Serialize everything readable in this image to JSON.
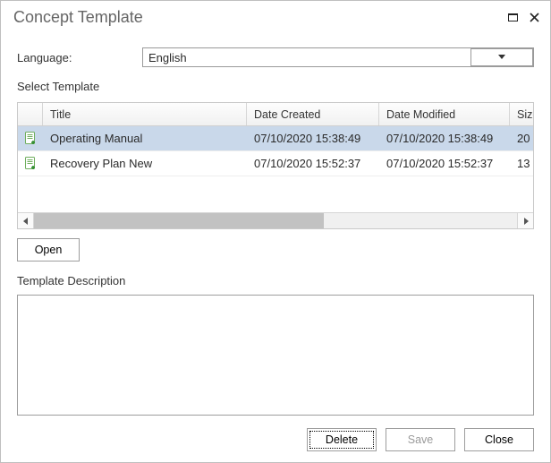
{
  "window": {
    "title": "Concept Template"
  },
  "language": {
    "label": "Language:",
    "value": "English"
  },
  "select_template_label": "Select Template",
  "grid": {
    "columns": {
      "title": "Title",
      "created": "Date Created",
      "modified": "Date Modified",
      "size": "Size"
    },
    "rows": [
      {
        "title": "Operating Manual",
        "created": "07/10/2020 15:38:49",
        "modified": "07/10/2020 15:38:49",
        "size": "20",
        "selected": true
      },
      {
        "title": "Recovery Plan New",
        "created": "07/10/2020 15:52:37",
        "modified": "07/10/2020 15:52:37",
        "size": "13",
        "selected": false
      }
    ]
  },
  "buttons": {
    "open": "Open",
    "delete": "Delete",
    "save": "Save",
    "close": "Close"
  },
  "description": {
    "label": "Template Description",
    "value": ""
  }
}
